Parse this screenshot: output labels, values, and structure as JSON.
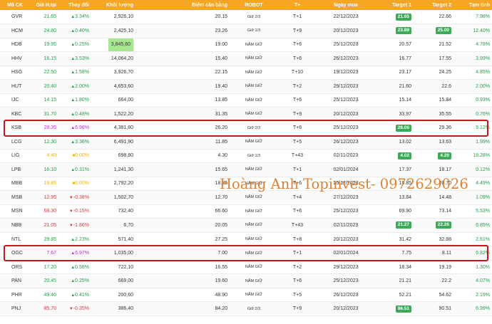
{
  "colors": {
    "header_bg": "#f6a623",
    "up": "#22a04b",
    "down": "#d23c3c",
    "reference": "#f0b400",
    "ceiling": "#b432c8",
    "target_badge": "#3daa58",
    "volume_highlight": "#a8e690",
    "row_outline": "#c11a1a",
    "watermark": "#e08030"
  },
  "watermark": "Hoàng Anh Topinvest- 0972629026",
  "columns": [
    "Mã CK",
    "Giá H.tại",
    "Thay đổi",
    "Khối lượng",
    "Điểm cân bằng",
    "ROBOT",
    "T+",
    "Ngày mua",
    "Target 1",
    "Target 2",
    "Tạm tính"
  ],
  "rows": [
    {
      "code": "GVR",
      "price": "21.65",
      "change": "3.34%",
      "dir": "up",
      "volume": "2,926,10",
      "balance": "20.15",
      "robot": "Giữ 2/3",
      "tplus": "T+1",
      "date": "22/12/2023",
      "target1": "21.65",
      "target1_badge": true,
      "target2": "22.66",
      "target2_badge": false,
      "profit": "7.98%"
    },
    {
      "code": "HCM",
      "price": "24.80",
      "change": "0.40%",
      "dir": "up",
      "volume": "2,425,10",
      "balance": "23.26",
      "robot": "Giữ 1/3",
      "tplus": "T+9",
      "date": "20/12/2023",
      "target1": "23.89",
      "target1_badge": true,
      "target2": "25.00",
      "target2_badge": true,
      "profit": "12.40%"
    },
    {
      "code": "HDB",
      "price": "19.95",
      "change": "0.25%",
      "dir": "up",
      "volume": "3,845,60",
      "volume_highlight": true,
      "balance": "19.00",
      "robot": "NẮM GIỮ",
      "tplus": "T+6",
      "date": "25/12/2023",
      "target1": "20.57",
      "target1_badge": false,
      "target2": "21.52",
      "target2_badge": false,
      "profit": "4.78%"
    },
    {
      "code": "HHV",
      "price": "16.15",
      "change": "3.53%",
      "dir": "up",
      "volume": "14,064,20",
      "balance": "15.40",
      "robot": "NẮM GIỮ",
      "tplus": "T+6",
      "date": "26/12/2023",
      "target1": "16.77",
      "target1_badge": false,
      "target2": "17.55",
      "target2_badge": false,
      "profit": "3.99%"
    },
    {
      "code": "HSG",
      "price": "22.50",
      "change": "1.58%",
      "dir": "up",
      "volume": "3,926,70",
      "balance": "22.15",
      "robot": "NẮM GIỮ",
      "tplus": "T+10",
      "date": "19/12/2023",
      "target1": "23.17",
      "target1_badge": false,
      "target2": "24.25",
      "target2_badge": false,
      "profit": "4.85%"
    },
    {
      "code": "HUT",
      "price": "20.40",
      "change": "2.00%",
      "dir": "up",
      "volume": "4,653,60",
      "balance": "19.40",
      "robot": "NẮM GIỮ",
      "tplus": "T+2",
      "date": "29/12/2023",
      "target1": "21.60",
      "target1_badge": false,
      "target2": "22.6",
      "target2_badge": false,
      "profit": "2.00%"
    },
    {
      "code": "IJC",
      "price": "14.15",
      "change": "1.80%",
      "dir": "up",
      "volume": "664,00",
      "balance": "13.85",
      "robot": "NẮM GIỮ",
      "tplus": "T+6",
      "date": "25/12/2023",
      "target1": "15.14",
      "target1_badge": false,
      "target2": "15.84",
      "target2_badge": false,
      "profit": "0.93%"
    },
    {
      "code": "KBC",
      "price": "31.70",
      "change": "0.48%",
      "dir": "up",
      "volume": "1,522,20",
      "balance": "31.35",
      "robot": "NẮM GIỮ",
      "tplus": "T+9",
      "date": "20/12/2023",
      "target1": "33.97",
      "target1_badge": false,
      "target2": "35.55",
      "target2_badge": false,
      "profit": "0.76%"
    },
    {
      "code": "KSB",
      "price": "28.35",
      "change": "6.98%",
      "dir": "ceil",
      "volume": "4,381,80",
      "balance": "26.20",
      "robot": "Giữ 2/3",
      "tplus": "T+6",
      "date": "25/12/2023",
      "target1": "28.06",
      "target1_badge": true,
      "target2": "29.36",
      "target2_badge": false,
      "profit": "9.12%"
    },
    {
      "code": "LCG",
      "price": "12.30",
      "change": "3.36%",
      "dir": "up",
      "volume": "6,491,90",
      "balance": "11.85",
      "robot": "NẮM GIỮ",
      "tplus": "T+5",
      "date": "26/12/2023",
      "target1": "13.02",
      "target1_badge": false,
      "target2": "13.63",
      "target2_badge": false,
      "profit": "1.99%"
    },
    {
      "code": "LIG",
      "price": "4.40",
      "change": "0.00%",
      "dir": "ref",
      "volume": "698,80",
      "balance": "4.30",
      "robot": "Giữ 1/3",
      "tplus": "T+43",
      "date": "02/11/2023",
      "target1": "4.02",
      "target1_badge": true,
      "target2": "4.20",
      "target2_badge": true,
      "profit": "18.28%"
    },
    {
      "code": "LPB",
      "price": "16.10",
      "change": "0.31%",
      "dir": "up",
      "volume": "1,241,30",
      "balance": "15.65",
      "robot": "NẮM GIỮ",
      "tplus": "T+1",
      "date": "02/01/2024",
      "target1": "17.37",
      "target1_badge": false,
      "target2": "18.17",
      "target2_badge": false,
      "profit": "0.12%"
    },
    {
      "code": "MBB",
      "price": "19.85",
      "change": "0.00%",
      "dir": "ref",
      "volume": "2,792,20",
      "balance": "18.35",
      "robot": "NẮM GIỮ",
      "tplus": "T+6",
      "date": "25/12/2023",
      "target1": "19.85",
      "target1_badge": false,
      "target2": "20.70",
      "target2_badge": false,
      "profit": "4.49%"
    },
    {
      "code": "MSB",
      "price": "12.95",
      "change": "-0.38%",
      "dir": "down",
      "volume": "1,502,70",
      "balance": "12.70",
      "robot": "NẮM GIỮ",
      "tplus": "T+4",
      "date": "27/12/2023",
      "target1": "13.84",
      "target1_badge": false,
      "target2": "14.48",
      "target2_badge": false,
      "profit": "1.09%"
    },
    {
      "code": "MSN",
      "price": "68.30",
      "change": "-0.15%",
      "dir": "down",
      "volume": "732,40",
      "balance": "66.60",
      "robot": "NẮM GIỮ",
      "tplus": "T+6",
      "date": "25/12/2023",
      "target1": "69.90",
      "target1_badge": false,
      "target2": "73.14",
      "target2_badge": false,
      "profit": "5.53%"
    },
    {
      "code": "NBB",
      "price": "21.05",
      "change": "-1.86%",
      "dir": "down",
      "volume": "6,70",
      "balance": "20.05",
      "robot": "NẮM GIỮ",
      "tplus": "T+43",
      "date": "02/11/2023",
      "target1": "21.27",
      "target1_badge": true,
      "target2": "22.26",
      "target2_badge": true,
      "profit": "6.85%"
    },
    {
      "code": "NTL",
      "price": "29.85",
      "change": "2.23%",
      "dir": "up",
      "volume": "571,40",
      "balance": "27.25",
      "robot": "NẮM GIỮ",
      "tplus": "T+8",
      "date": "20/12/2023",
      "target1": "31.42",
      "target1_badge": false,
      "target2": "32.88",
      "target2_badge": false,
      "profit": "2.61%"
    },
    {
      "code": "OGC",
      "price": "7.67",
      "change": "6.97%",
      "dir": "ceil",
      "volume": "1,035,00",
      "balance": "7.00",
      "robot": "NẮM GIỮ",
      "tplus": "T+1",
      "date": "02/01/2024",
      "target1": "7.75",
      "target1_badge": false,
      "target2": "8.11",
      "target2_badge": false,
      "profit": "6.82%"
    },
    {
      "code": "ORS",
      "price": "17.20",
      "change": "0.58%",
      "dir": "up",
      "volume": "722,10",
      "balance": "16.55",
      "robot": "NẮM GIỮ",
      "tplus": "T+2",
      "date": "29/12/2023",
      "target1": "18.34",
      "target1_badge": false,
      "target2": "19.19",
      "target2_badge": false,
      "profit": "1.30%"
    },
    {
      "code": "PAN",
      "price": "20.45",
      "change": "0.25%",
      "dir": "up",
      "volume": "669,00",
      "balance": "19.60",
      "robot": "NẮM GIỮ",
      "tplus": "T+6",
      "date": "25/12/2023",
      "target1": "21.21",
      "target1_badge": false,
      "target2": "22.2",
      "target2_badge": false,
      "profit": "4.07%"
    },
    {
      "code": "PHR",
      "price": "49.40",
      "change": "0.41%",
      "dir": "up",
      "volume": "200,60",
      "balance": "48.90",
      "robot": "NẮM GIỮ",
      "tplus": "T+5",
      "date": "26/12/2023",
      "target1": "52.21",
      "target1_badge": false,
      "target2": "54.62",
      "target2_badge": false,
      "profit": "2.19%"
    },
    {
      "code": "PNJ",
      "price": "85.70",
      "change": "-0.35%",
      "dir": "down",
      "volume": "386,40",
      "balance": "84.20",
      "robot": "Giữ 2/3",
      "tplus": "T+9",
      "date": "20/12/2023",
      "target1": "86.51",
      "target1_badge": true,
      "target2": "90.51",
      "target2_badge": false,
      "profit": "6.99%"
    }
  ],
  "highlighted_rows": [
    8,
    17
  ]
}
